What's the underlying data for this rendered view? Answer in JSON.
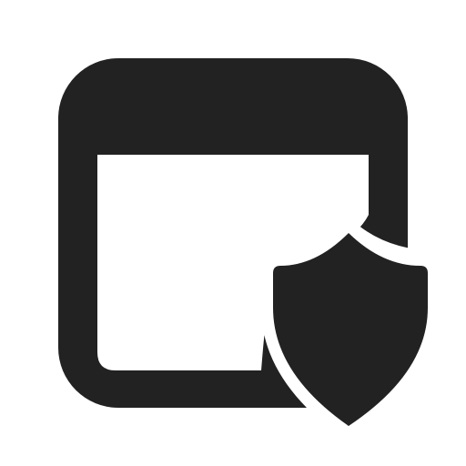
{
  "icon": {
    "name": "window-shield-icon",
    "color": "#222222",
    "background": "#ffffff"
  }
}
